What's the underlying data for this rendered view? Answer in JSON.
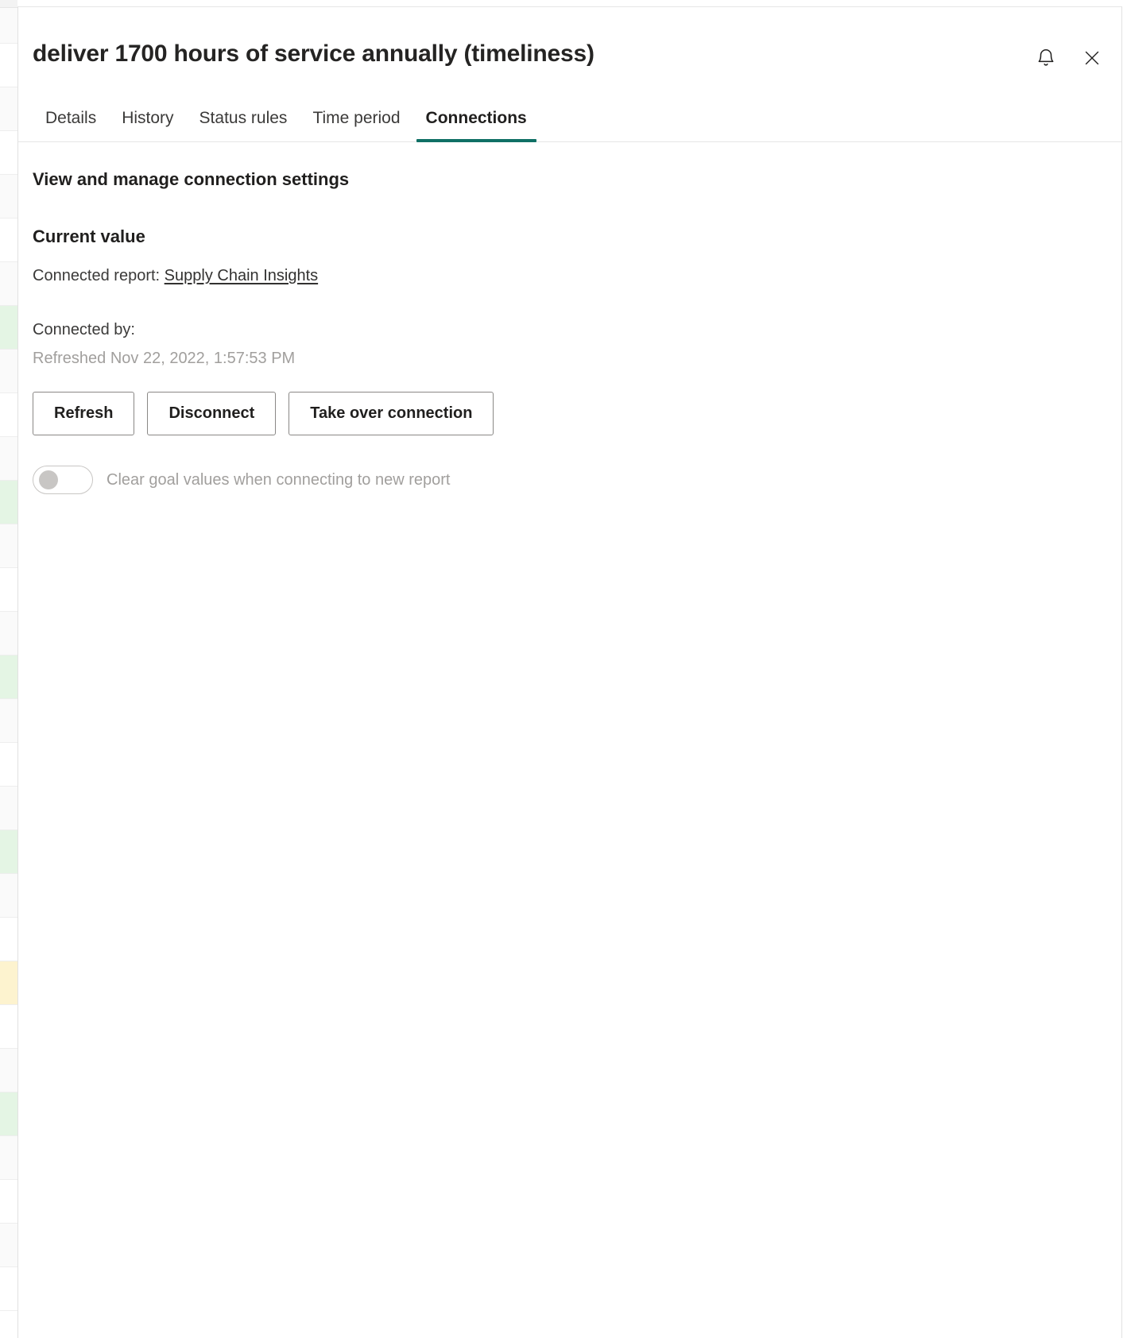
{
  "window": {
    "title": "deliver 1700 hours of service annually (timeliness)",
    "notifications_icon": "bell-icon",
    "close_icon": "close-icon"
  },
  "tabs": [
    {
      "label": "Details",
      "active": false
    },
    {
      "label": "History",
      "active": false
    },
    {
      "label": "Status rules",
      "active": false
    },
    {
      "label": "Time period",
      "active": false
    },
    {
      "label": "Connections",
      "active": true
    }
  ],
  "body": {
    "section_heading": "View and manage connection settings",
    "current_value_heading": "Current value",
    "connected_report_label": "Connected report:",
    "connected_report_link": "Supply Chain Insights",
    "connected_by_label": "Connected by:",
    "refreshed_text": "Refreshed Nov 22, 2022, 1:57:53 PM",
    "buttons": [
      {
        "label": "Refresh"
      },
      {
        "label": "Disconnect"
      },
      {
        "label": "Take over connection"
      }
    ],
    "toggle": {
      "label": "Clear goal values when connecting to new report",
      "state": "off",
      "disabled": true
    }
  },
  "colors": {
    "accent_teal": "#0f7065",
    "text_primary": "#201f1e",
    "text_secondary": "#3b3a39",
    "text_disabled": "#a19f9d",
    "border": "#e6e6e6",
    "button_border": "#8a8886",
    "status_green": "#e4f5e4",
    "status_yellow": "#fdf3cf"
  },
  "background_page": {
    "rows": [
      {
        "status": "none"
      },
      {
        "status": "none"
      },
      {
        "status": "none"
      },
      {
        "status": "none"
      },
      {
        "status": "none"
      },
      {
        "status": "none"
      },
      {
        "status": "none"
      },
      {
        "status": "green"
      },
      {
        "status": "none"
      },
      {
        "status": "none"
      },
      {
        "status": "none"
      },
      {
        "status": "green"
      },
      {
        "status": "none"
      },
      {
        "status": "none"
      },
      {
        "status": "none"
      },
      {
        "status": "green"
      },
      {
        "status": "none"
      },
      {
        "status": "none"
      },
      {
        "status": "none"
      },
      {
        "status": "green"
      },
      {
        "status": "none"
      },
      {
        "status": "none"
      },
      {
        "status": "yellow"
      },
      {
        "status": "none"
      },
      {
        "status": "none"
      },
      {
        "status": "green"
      },
      {
        "status": "none"
      },
      {
        "status": "none"
      },
      {
        "status": "none"
      },
      {
        "status": "none"
      }
    ]
  }
}
